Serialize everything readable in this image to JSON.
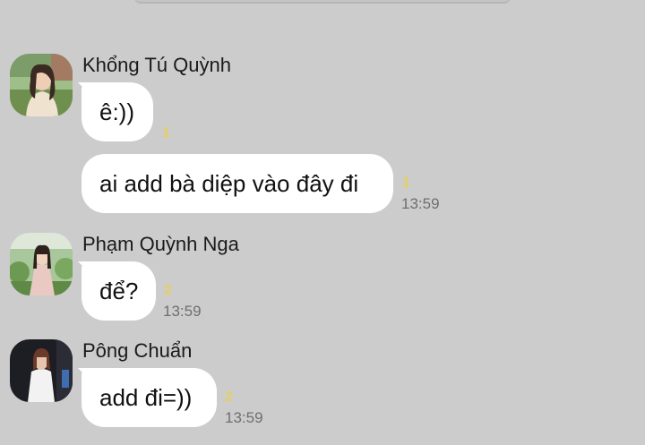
{
  "messages": [
    {
      "sender": "Khổng Tú Quỳnh",
      "avatar_icon": "avatar-photo-girl-park",
      "lines": [
        {
          "text": "ê:))",
          "seen": "1",
          "time": ""
        },
        {
          "text": "ai add bà diệp vào đây đi",
          "seen": "1",
          "time": "13:59"
        }
      ]
    },
    {
      "sender": "Phạm Quỳnh Nga",
      "avatar_icon": "avatar-photo-girl-garden",
      "lines": [
        {
          "text": "để?",
          "seen": "2",
          "time": "13:59"
        }
      ]
    },
    {
      "sender": "Pông Chuẩn",
      "avatar_icon": "avatar-photo-girl-dark",
      "lines": [
        {
          "text": "add đi=))",
          "seen": "2",
          "time": "13:59"
        }
      ]
    }
  ],
  "colors": {
    "background": "#cccccc",
    "bubble": "#ffffff",
    "seen_count": "#e8cf5a",
    "timestamp": "#6f6f6f"
  }
}
